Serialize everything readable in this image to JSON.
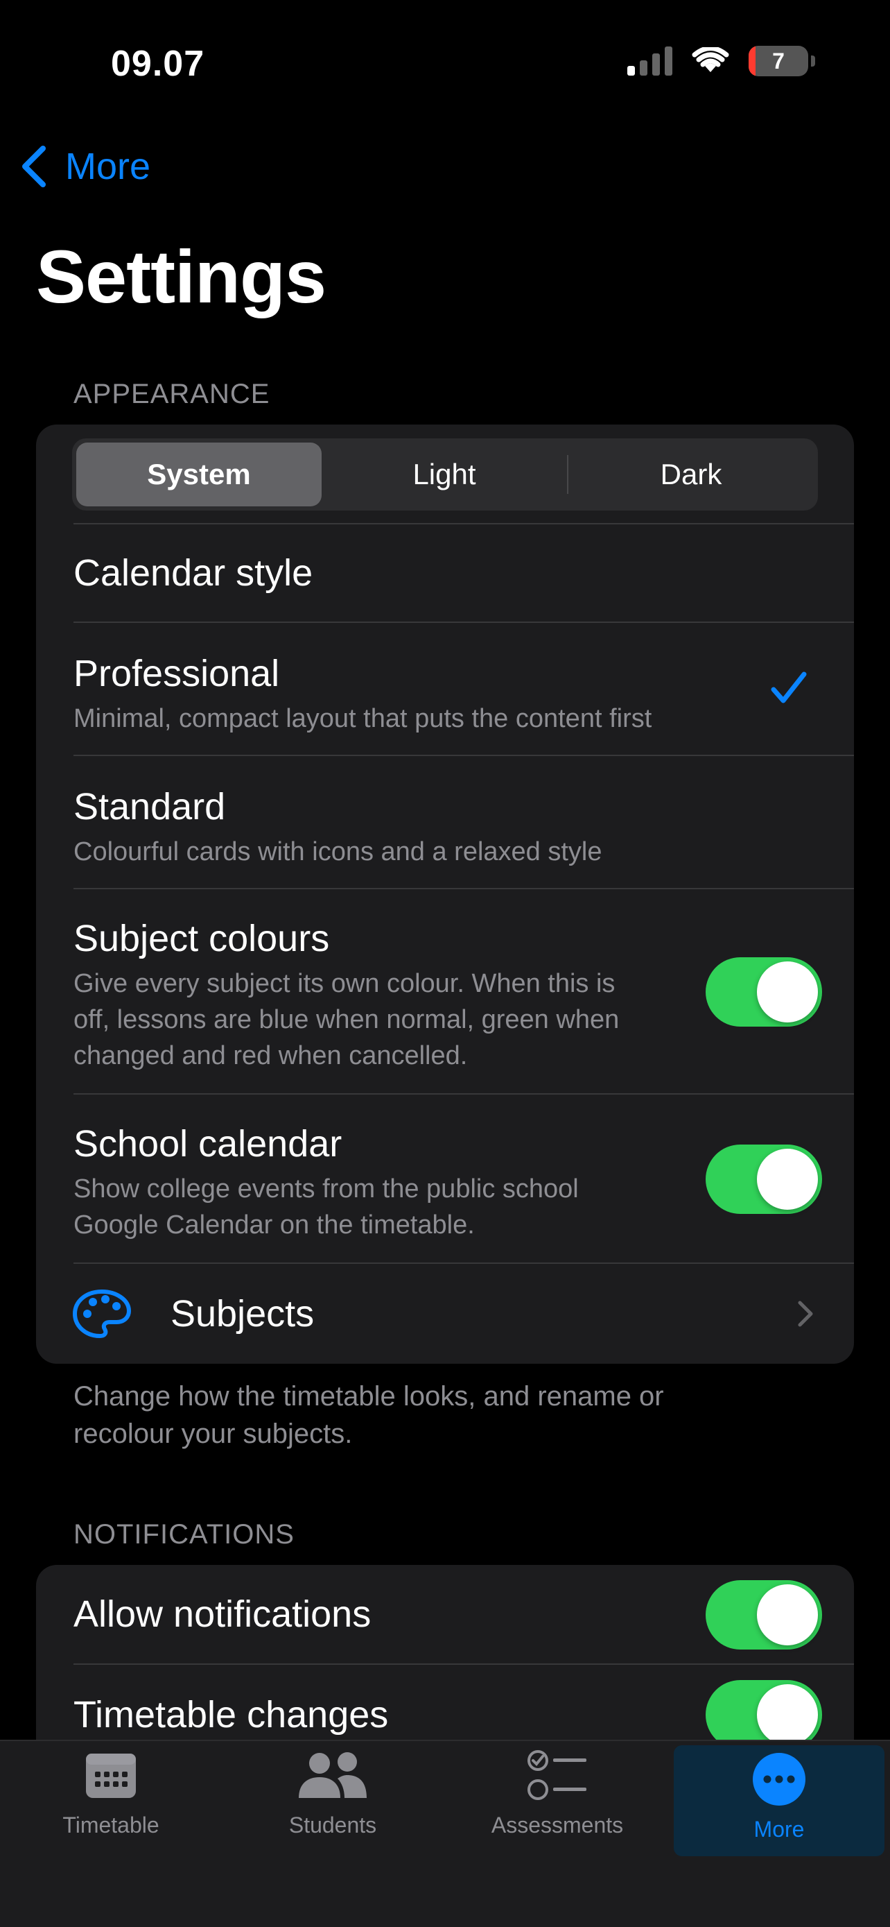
{
  "status_bar": {
    "time": "09.07",
    "battery": "7"
  },
  "nav": {
    "back_label": "More",
    "title": "Settings"
  },
  "appearance": {
    "header": "APPEARANCE",
    "segments": [
      "System",
      "Light",
      "Dark"
    ],
    "selected_segment": "System",
    "calendar_style_label": "Calendar style",
    "professional": {
      "title": "Professional",
      "subtitle": "Minimal, compact layout that puts the content first",
      "checked": true
    },
    "standard": {
      "title": "Standard",
      "subtitle": "Colourful cards with icons and a relaxed style"
    },
    "subject_colours": {
      "title": "Subject colours",
      "subtitle_lines": [
        "Give every subject its own colour. When this is",
        "off, lessons are blue when normal, green when",
        "changed and red when cancelled."
      ],
      "enabled": true
    },
    "school_calendar": {
      "title": "School calendar",
      "subtitle_lines": [
        "Show college events from the public school",
        "Google Calendar on the timetable."
      ],
      "enabled": true
    },
    "subjects": {
      "title": "Subjects",
      "icon": "palette-icon"
    },
    "footer_lines": [
      "Change how the timetable looks, and rename or",
      "recolour your subjects."
    ]
  },
  "notifications": {
    "header": "NOTIFICATIONS",
    "allow": {
      "title": "Allow notifications",
      "enabled": true
    },
    "timetable_changes": {
      "title": "Timetable changes",
      "enabled": true
    }
  },
  "tabbar": {
    "tabs": [
      {
        "label": "Timetable",
        "icon": "calendar-icon"
      },
      {
        "label": "Students",
        "icon": "people-icon"
      },
      {
        "label": "Assessments",
        "icon": "checklist-icon"
      },
      {
        "label": "More",
        "icon": "more-icon"
      }
    ],
    "selected": "More"
  },
  "colors": {
    "accent": "#0a84ff",
    "toggle_on": "#30d158",
    "group_bg": "#1c1c1e",
    "secondary_text": "#8e8e93"
  }
}
